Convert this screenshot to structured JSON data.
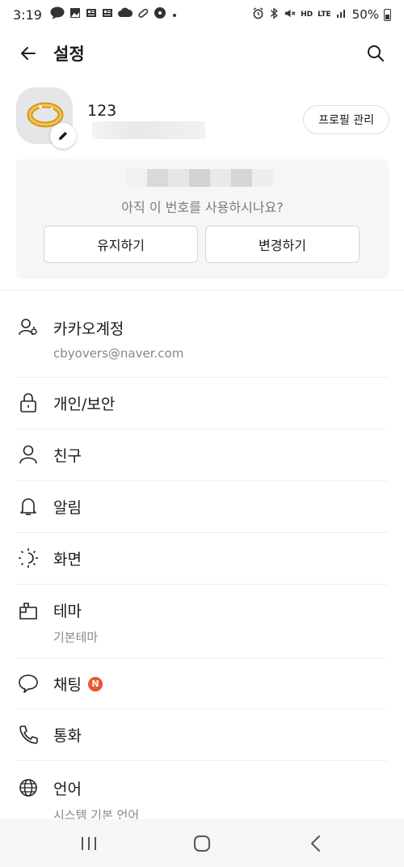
{
  "status_bar": {
    "time": "3:19",
    "battery": "50%",
    "network": "LTE",
    "voice": "HD",
    "left_icons": [
      "talk-icon",
      "image-icon",
      "news-icon",
      "news-icon",
      "cloud-icon",
      "pill-icon",
      "settings-badge-icon",
      "dot-icon"
    ],
    "right_icons": [
      "alarm-icon",
      "bluetooth-icon",
      "mute-icon",
      "hd-voice-icon",
      "lte-icon",
      "signal-icon",
      "battery-icon"
    ]
  },
  "header": {
    "title": "설정"
  },
  "profile": {
    "name": "123",
    "manage_label": "프로필 관리"
  },
  "number_card": {
    "question": "아직 이 번호를 사용하시나요?",
    "keep_label": "유지하기",
    "change_label": "변경하기"
  },
  "menu": {
    "items": [
      {
        "label": "카카오계정",
        "sub": "cbyovers@naver.com",
        "icon": "account-icon"
      },
      {
        "label": "개인/보안",
        "icon": "lock-icon"
      },
      {
        "label": "친구",
        "icon": "person-icon"
      },
      {
        "label": "알림",
        "icon": "bell-icon"
      },
      {
        "label": "화면",
        "icon": "brightness-icon"
      },
      {
        "label": "테마",
        "sub": "기본테마",
        "icon": "theme-icon"
      },
      {
        "label": "채팅",
        "badge": "N",
        "icon": "chat-bubble-icon"
      },
      {
        "label": "통화",
        "icon": "phone-icon"
      },
      {
        "label": "언어",
        "sub": "시스템 기본 언어",
        "icon": "globe-icon"
      }
    ]
  },
  "colors": {
    "badge": "#e9582f",
    "card_bg": "#f6f6f7",
    "secondary_text": "#888888"
  }
}
